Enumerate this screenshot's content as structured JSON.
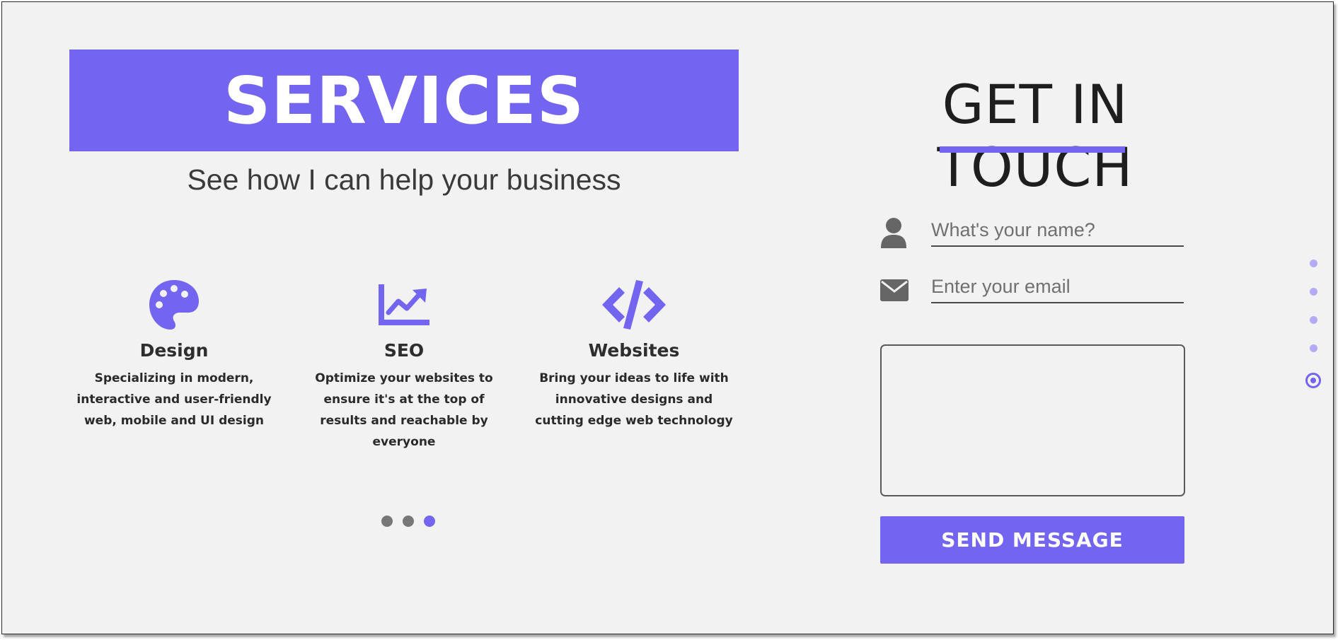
{
  "services": {
    "title": "SERVICES",
    "subtitle": "See how I can help your business",
    "cards": [
      {
        "icon": "palette-icon",
        "name": "Design",
        "description": "Specializing in modern, interactive and user-friendly web, mobile and UI design"
      },
      {
        "icon": "chart-line-icon",
        "name": "SEO",
        "description": "Optimize your websites to ensure it's at the top of results and reachable by everyone"
      },
      {
        "icon": "code-icon",
        "name": "Websites",
        "description": "Bring your ideas to life with innovative designs and cutting edge web technology"
      }
    ],
    "carousel": {
      "count": 3,
      "active_index": 2
    }
  },
  "contact": {
    "title": "GET IN TOUCH",
    "name_field": {
      "icon": "user-icon",
      "placeholder": "What's your name?",
      "value": ""
    },
    "email_field": {
      "icon": "envelope-icon",
      "placeholder": "Enter your email",
      "value": ""
    },
    "message_field": {
      "value": ""
    },
    "send_label": "SEND MESSAGE"
  },
  "page_nav": {
    "count": 5,
    "active_index": 4
  },
  "colors": {
    "accent": "#7365ef",
    "background": "#f2f2f2",
    "text_dark": "#2a2a2a",
    "icon_gray": "#666666"
  }
}
